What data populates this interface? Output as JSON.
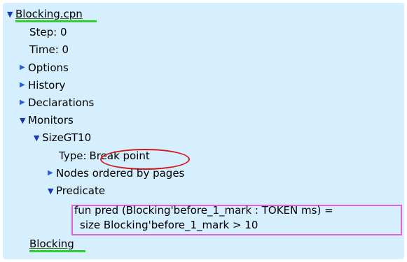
{
  "tree": {
    "root": {
      "label": "Blocking.cpn",
      "expander": "expanded"
    },
    "step": "Step: 0",
    "time": "Time: 0",
    "options": {
      "label": "Options",
      "expander": "collapsed"
    },
    "history": {
      "label": "History",
      "expander": "collapsed"
    },
    "declarations": {
      "label": "Declarations",
      "expander": "collapsed"
    },
    "monitors": {
      "label": "Monitors",
      "expander": "expanded",
      "monitor": {
        "label": "SizeGT10",
        "expander": "expanded",
        "type_prefix": "Type:",
        "type_value": "Break point",
        "nodes": {
          "label": "Nodes ordered by pages",
          "expander": "collapsed"
        },
        "predicate": {
          "label": "Predicate",
          "expander": "expanded",
          "code_line1": "fun pred (Blocking'before_1_mark : TOKEN ms) =",
          "code_line2": "size Blocking'before_1_mark > 10"
        }
      }
    },
    "page_link": "Blocking"
  },
  "icons": {
    "expanded": "triangle-down-icon",
    "collapsed": "triangle-right-icon"
  },
  "colors": {
    "panel_background": "#d6efff",
    "expander": "#1a3ab5",
    "underline_highlight": "#33cc33",
    "annotation_ellipse": "#d21a1a",
    "annotation_box": "#e060e0"
  }
}
